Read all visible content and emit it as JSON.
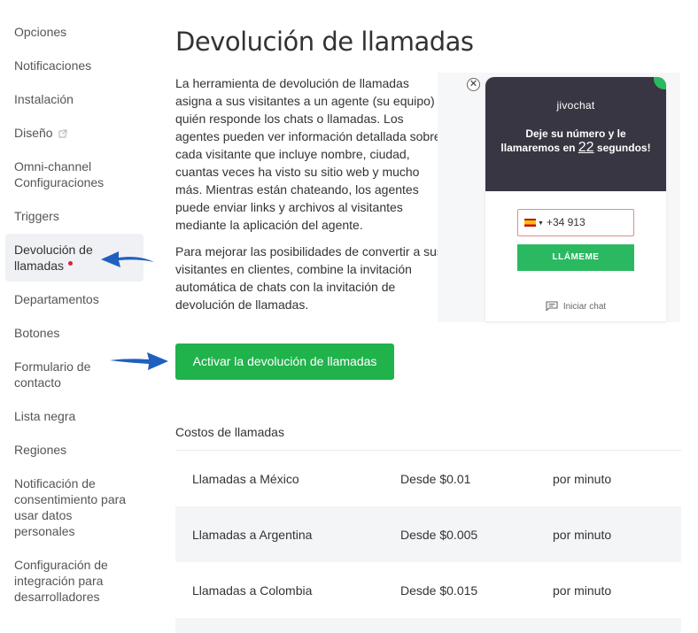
{
  "sidebar": {
    "items": [
      {
        "label": "Opciones"
      },
      {
        "label": "Notificaciones"
      },
      {
        "label": "Instalación"
      },
      {
        "label": "Diseño"
      },
      {
        "label": "Omni-channel Configuraciones"
      },
      {
        "label": "Triggers"
      },
      {
        "label": "Devolución de llamadas"
      },
      {
        "label": "Departamentos"
      },
      {
        "label": "Botones"
      },
      {
        "label": "Formulario de contacto"
      },
      {
        "label": "Lista negra"
      },
      {
        "label": "Regiones"
      },
      {
        "label": "Notificación de consentimiento para usar datos personales"
      },
      {
        "label": "Configuración de integración para desarrolladores"
      }
    ]
  },
  "main": {
    "title": "Devolución de llamadas",
    "paragraph1": "La herramienta de devolución de llamadas asigna a sus visitantes a un agente (su equipo) quién responde los chats o llamadas. Los agentes pueden ver información detallada sobre cada visitante que incluye nombre, ciudad, cuantas veces ha visto su sitio web y mucho más. Mientras están chateando, los agentes puede enviar links y archivos al visitantes mediante la aplicación del agente.",
    "paragraph2": "Para mejorar las posibilidades de convertir a sus visitantes en clientes, combine la invitación automática de chats con la invitación de devolución de llamadas.",
    "activate_button": "Activar la devolución de llamadas"
  },
  "widget": {
    "logo": "jivochat",
    "text_before": "Deje su número y le llamaremos en ",
    "seconds": "22",
    "text_after": " segundos!",
    "phone_value": "+34 913",
    "call_button": "LLÁMEME",
    "start_chat": "Iniciar chat"
  },
  "costs": {
    "title": "Costos de llamadas",
    "rows": [
      {
        "country": "Llamadas a México",
        "price": "Desde $0.01",
        "unit": "por minuto"
      },
      {
        "country": "Llamadas a Argentina",
        "price": "Desde $0.005",
        "unit": "por minuto"
      },
      {
        "country": "Llamadas a Colombia",
        "price": "Desde $0.015",
        "unit": "por minuto"
      }
    ]
  },
  "colors": {
    "accent_green": "#20b24b",
    "arrow_blue": "#1f5fbf",
    "widget_dark": "#383642",
    "notification_red": "#e3203f"
  }
}
